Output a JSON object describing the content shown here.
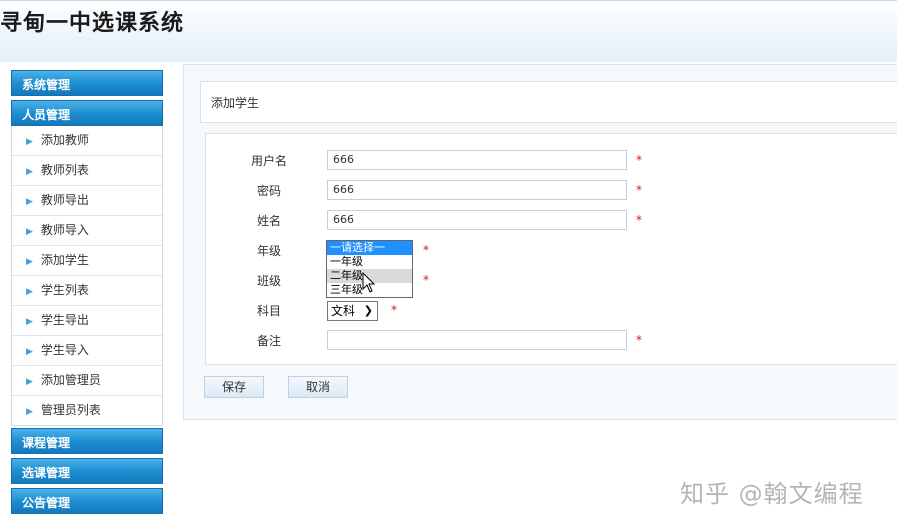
{
  "header": {
    "title": "寻甸一中选课系统"
  },
  "sidebar": {
    "groups": [
      {
        "label": "系统管理"
      },
      {
        "label": "人员管理"
      },
      {
        "label": "课程管理"
      },
      {
        "label": "选课管理"
      },
      {
        "label": "公告管理"
      }
    ],
    "items": [
      {
        "label": "添加教师"
      },
      {
        "label": "教师列表"
      },
      {
        "label": "教师导出"
      },
      {
        "label": "教师导入"
      },
      {
        "label": "添加学生"
      },
      {
        "label": "学生列表"
      },
      {
        "label": "学生导出"
      },
      {
        "label": "学生导入"
      },
      {
        "label": "添加管理员"
      },
      {
        "label": "管理员列表"
      }
    ]
  },
  "page": {
    "title": "添加学生"
  },
  "form": {
    "username": {
      "label": "用户名",
      "value": "666"
    },
    "password": {
      "label": "密码",
      "value": "666"
    },
    "name": {
      "label": "姓名",
      "value": "666"
    },
    "grade": {
      "label": "年级",
      "options": [
        "一请选择一",
        "一年级",
        "二年级",
        "三年级"
      ],
      "selected_index": 0,
      "hovered_index": 2
    },
    "class": {
      "label": "班级"
    },
    "subject": {
      "label": "科目",
      "value": "文科"
    },
    "note": {
      "label": "备注",
      "value": ""
    },
    "required_mark": "*"
  },
  "buttons": {
    "save": "保存",
    "cancel": "取消"
  },
  "watermark": "知乎 @翰文编程",
  "icons": {
    "sidebar_arrow": "chevron-right-icon",
    "select_chevron": "chevron-down-icon",
    "cursor": "mouse-pointer-icon"
  },
  "colors": {
    "accent": "#1e8fd2",
    "required": "#d81818",
    "selected_option": "#1e90ff"
  }
}
